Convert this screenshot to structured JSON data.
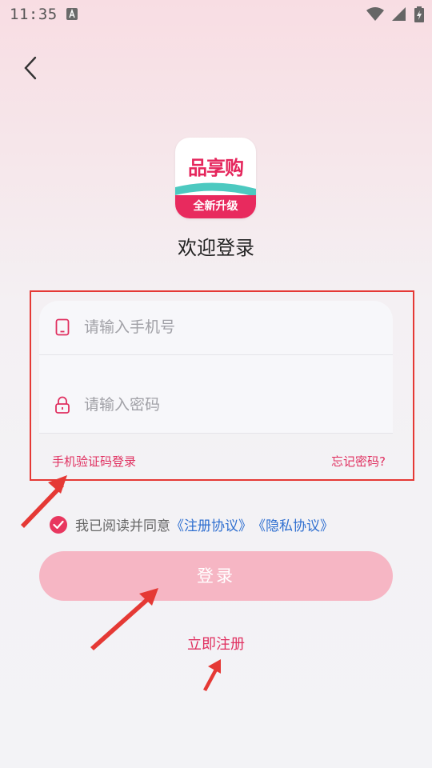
{
  "status_bar": {
    "time": "11:35"
  },
  "header": {
    "welcome": "欢迎登录"
  },
  "logo": {
    "top_text": "品享购",
    "bottom_text": "全新升级"
  },
  "form": {
    "phone_placeholder": "请输入手机号",
    "password_placeholder": "请输入密码",
    "sms_login_link": "手机验证码登录",
    "forgot_password_link": "忘记密码?"
  },
  "agreement": {
    "prefix": "我已阅读并同意",
    "register_agreement": "《注册协议》",
    "privacy_agreement": "《隐私协议》",
    "checked": true
  },
  "actions": {
    "login_label": "登录",
    "register_label": "立即注册"
  },
  "colors": {
    "accent": "#e8375f",
    "link_blue": "#2f6fd0",
    "button_pink": "#f6b6c4",
    "annotation_red": "#e53935"
  }
}
